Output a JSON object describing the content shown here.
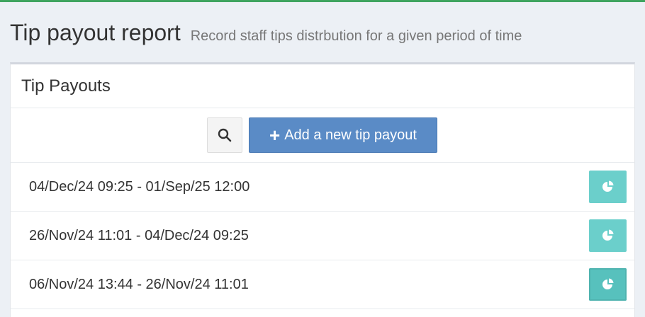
{
  "colors": {
    "accent_bar": "#3fa45f",
    "primary_button": "#5a8bc6",
    "report_button": "#6bcfcb",
    "background": "#ecf0f5"
  },
  "header": {
    "title": "Tip payout report",
    "subtitle": "Record staff tips distrbution for a given period of time"
  },
  "panel": {
    "title": "Tip Payouts",
    "search_icon": "search-icon",
    "add_button_label": "Add a new tip payout",
    "add_button_icon": "plus-icon"
  },
  "payouts": [
    {
      "range": "04/Dec/24 09:25 - 01/Sep/25 12:00",
      "icon": "pie-chart-icon"
    },
    {
      "range": "26/Nov/24 11:01 - 04/Dec/24 09:25",
      "icon": "pie-chart-icon"
    },
    {
      "range": "06/Nov/24 13:44 - 26/Nov/24 11:01",
      "icon": "pie-chart-icon"
    }
  ]
}
